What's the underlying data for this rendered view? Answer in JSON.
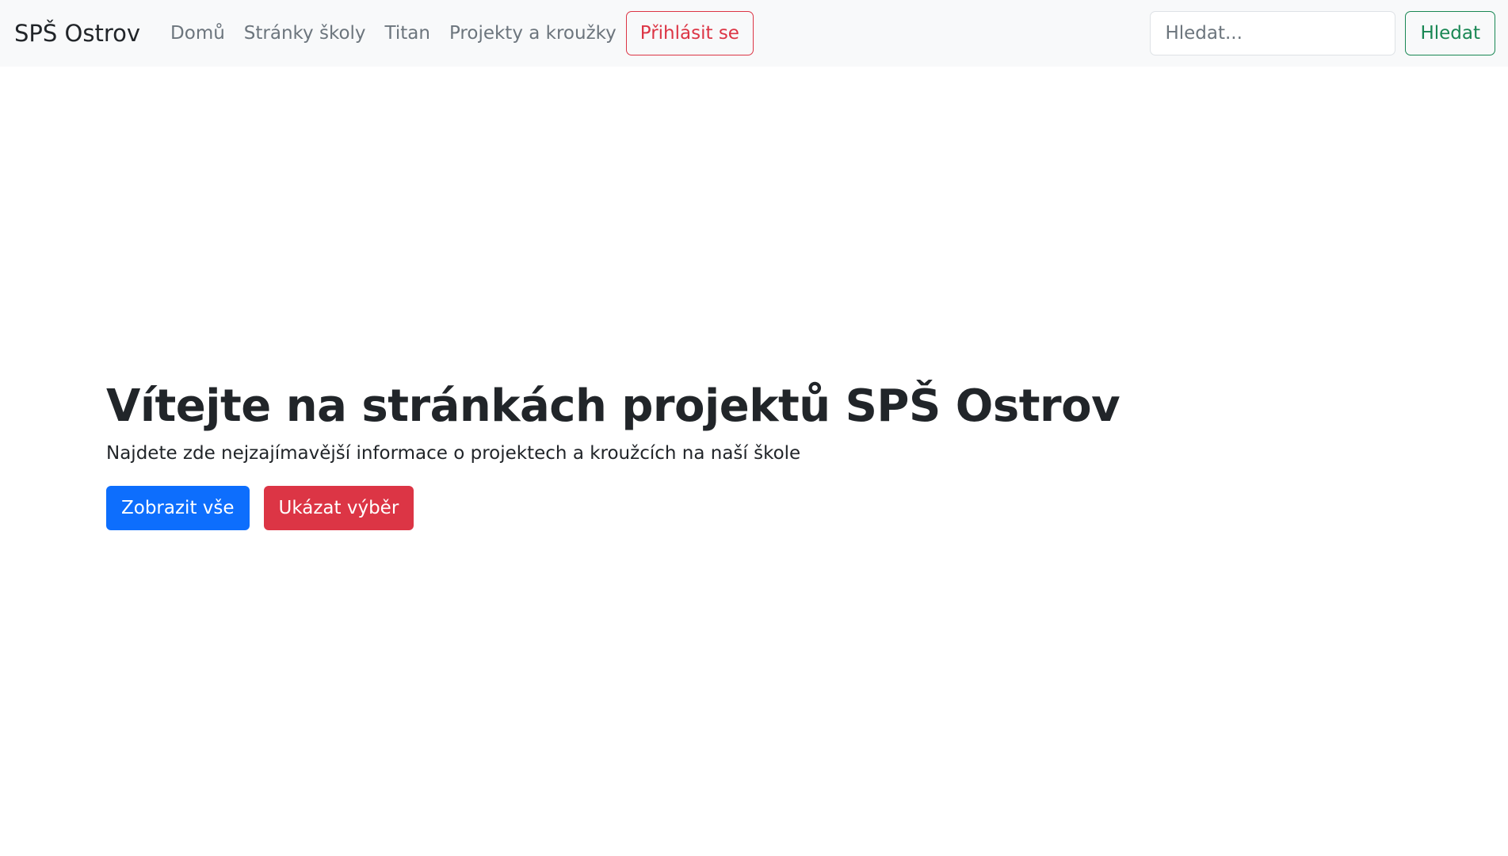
{
  "navbar": {
    "brand": "SPŠ Ostrov",
    "links": [
      {
        "label": "Domů"
      },
      {
        "label": "Stránky školy"
      },
      {
        "label": "Titan"
      },
      {
        "label": "Projekty a kroužky"
      }
    ],
    "login_label": "Přihlásit se",
    "search": {
      "placeholder": "Hledat...",
      "value": "",
      "button_label": "Hledat"
    }
  },
  "hero": {
    "title": "Vítejte na stránkách projektů SPŠ Ostrov",
    "lead": "Najdete zde nejzajímavější informace o projektech a kroužcích na naší škole",
    "primary_button": "Zobrazit vše",
    "secondary_button": "Ukázat výběr"
  },
  "colors": {
    "navbar_bg": "#f8f9fa",
    "primary": "#0d6efd",
    "danger": "#dc3545",
    "success": "#198754",
    "muted": "#6c757d"
  }
}
